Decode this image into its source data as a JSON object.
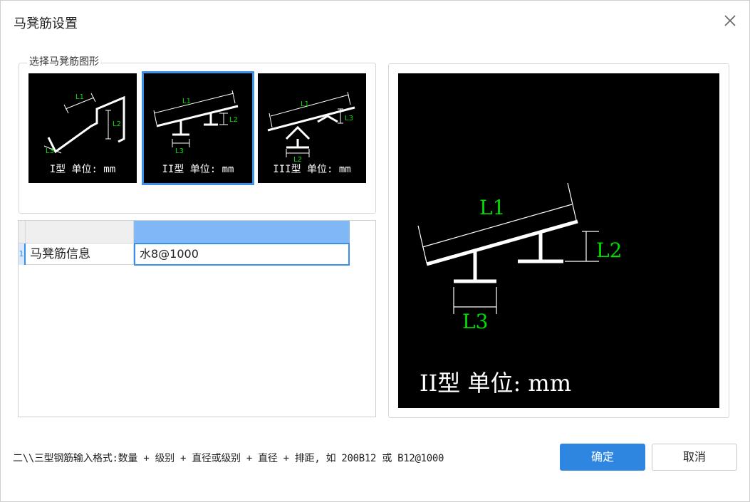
{
  "dialog": {
    "title": "马凳筋设置",
    "close_icon": "close-icon"
  },
  "shape_group": {
    "legend": "选择马凳筋图形",
    "selected_index": 1,
    "shapes": [
      {
        "label": "I型 单位: mm",
        "dims": [
          "L1",
          "L2",
          "L3"
        ]
      },
      {
        "label": "II型 单位: mm",
        "dims": [
          "L1",
          "L2",
          "L3"
        ]
      },
      {
        "label": "III型 单位: mm",
        "dims": [
          "L1",
          "L2",
          "L3"
        ]
      }
    ]
  },
  "preview": {
    "label": "II型 单位: mm",
    "dims": [
      "L1",
      "L2",
      "L3"
    ]
  },
  "table": {
    "rows": [
      {
        "index": "1",
        "name": "马凳筋信息",
        "value": "⽔8@1000"
      }
    ]
  },
  "footer": {
    "hint": "二\\\\三型钢筋输入格式:数量 + 级别 + 直径或级别 + 直径 + 排距, 如 200B12 或 B12@1000",
    "ok_label": "确定",
    "cancel_label": "取消"
  },
  "colors": {
    "accent": "#2f86e0",
    "dim_text": "#00dd00",
    "shape_bg": "#000000"
  }
}
